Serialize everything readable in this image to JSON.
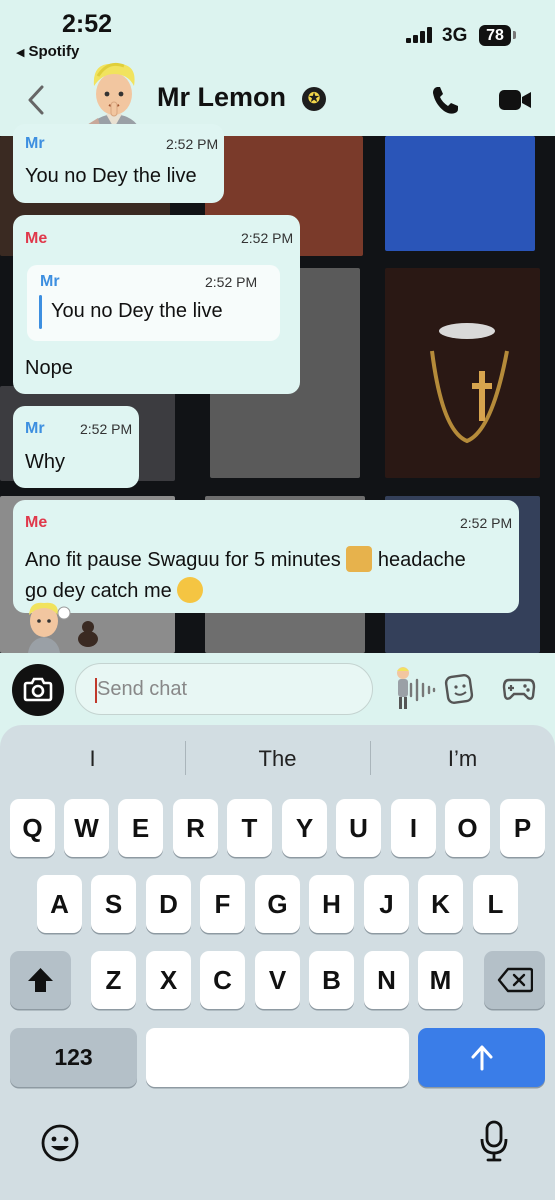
{
  "status_bar": {
    "time": "2:52",
    "back_app": "Spotify",
    "network": "3G",
    "battery": "78"
  },
  "header": {
    "title": "Mr Lemon"
  },
  "messages": [
    {
      "sender": "Mr",
      "time": "2:52 PM",
      "text": "You no Dey the live"
    },
    {
      "sender": "Me",
      "time": "2:52 PM",
      "quote": {
        "sender": "Mr",
        "time": "2:52 PM",
        "text": "You no Dey the live"
      },
      "text": "Nope"
    },
    {
      "sender": "Mr",
      "time": "2:52 PM",
      "text": "Why"
    },
    {
      "sender": "Me",
      "time": "2:52 PM",
      "line1": "Ano fit pause Swaguu for 5 minutes",
      "line1_end": "headache",
      "line2": "go dey catch me"
    }
  ],
  "input": {
    "placeholder": "Send chat"
  },
  "keyboard": {
    "suggestions": [
      "I",
      "The",
      "I’m"
    ],
    "row1": [
      "Q",
      "W",
      "E",
      "R",
      "T",
      "Y",
      "U",
      "I",
      "O",
      "P"
    ],
    "row2": [
      "A",
      "S",
      "D",
      "F",
      "G",
      "H",
      "J",
      "K",
      "L"
    ],
    "row3": [
      "Z",
      "X",
      "C",
      "V",
      "B",
      "N",
      "M"
    ],
    "numbers_key": "123"
  },
  "icons": [
    "back-chevron-icon",
    "star-badge-icon",
    "phone-icon",
    "video-icon",
    "camera-icon",
    "waveform-icon",
    "sticker-icon",
    "game-controller-icon",
    "shift-icon",
    "backspace-icon",
    "return-arrow-icon",
    "emoji-icon",
    "microphone-icon"
  ],
  "colors": {
    "mr_label": "#3d8fe0",
    "me_label": "#e0384b",
    "bubble": "#dff5f2",
    "app_bg": "#dcf3ef",
    "return_key": "#3a7de8"
  }
}
